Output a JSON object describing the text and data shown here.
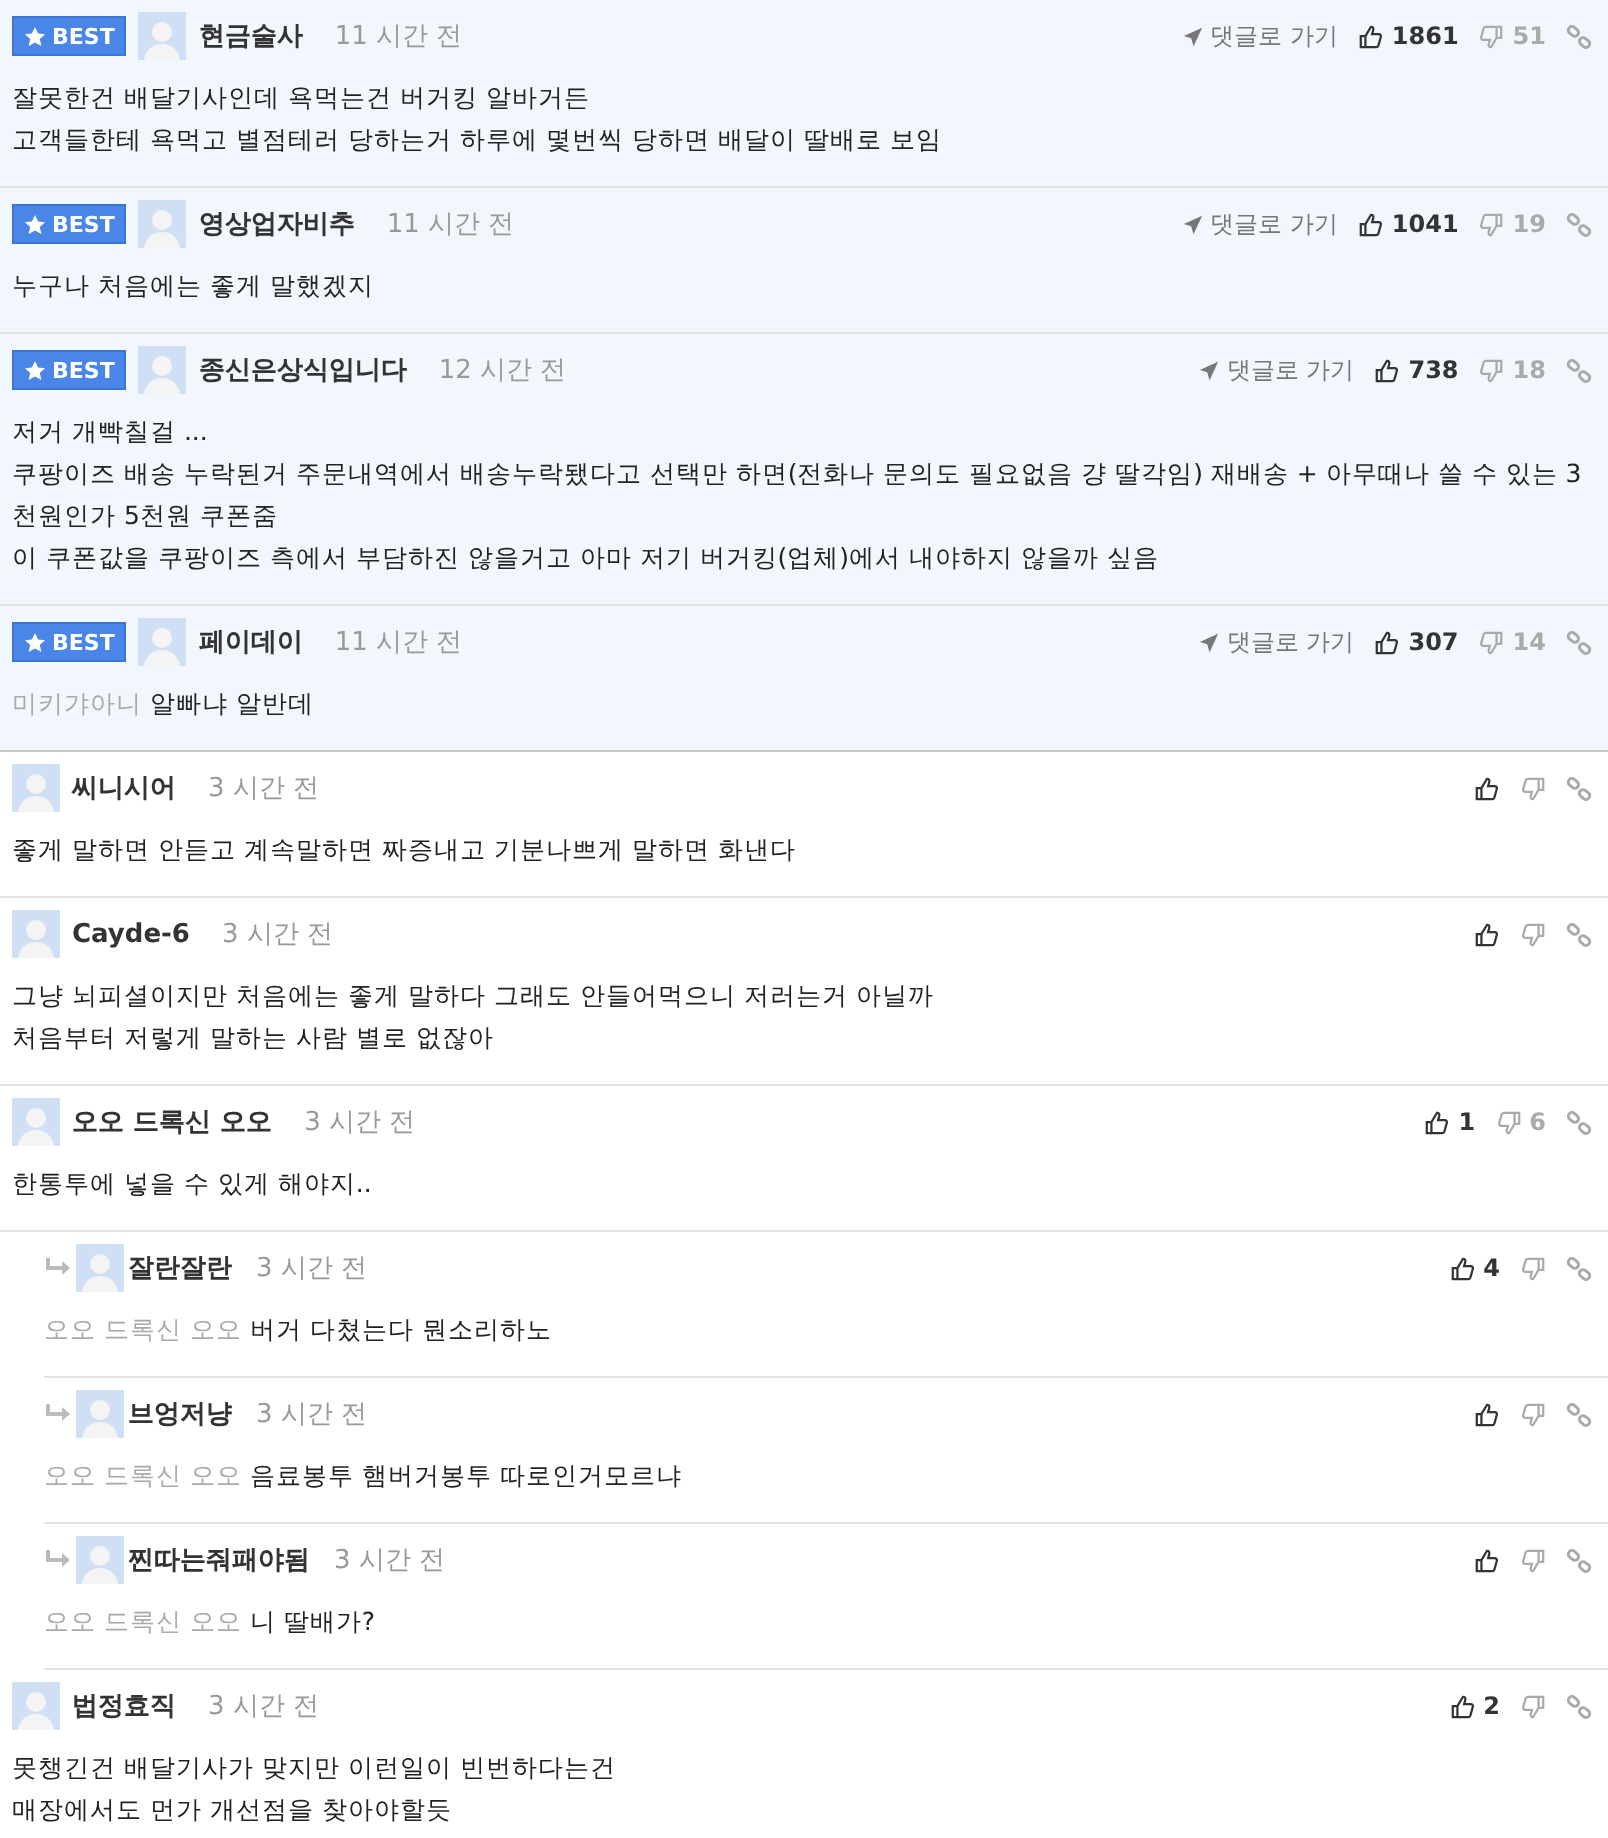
{
  "comments": [
    {
      "kind": "best",
      "badge": "BEST",
      "author": "현금술사",
      "time": "11 시간 전",
      "goto": "댓글로 가기",
      "likes": "1861",
      "dislikes": "51",
      "lines": [
        "잘못한건 배달기사인데 욕먹는건 버거킹 알바거든",
        "고객들한테 욕먹고 별점테러 당하는거 하루에 몇번씩 당하면 배달이 딸배로 보임"
      ]
    },
    {
      "kind": "best",
      "badge": "BEST",
      "author": "영상업자비추",
      "time": "11 시간 전",
      "goto": "댓글로 가기",
      "likes": "1041",
      "dislikes": "19",
      "lines": [
        "누구나 처음에는 좋게 말했겠지"
      ]
    },
    {
      "kind": "best",
      "badge": "BEST",
      "author": "종신은상식입니다",
      "time": "12 시간 전",
      "goto": "댓글로 가기",
      "likes": "738",
      "dislikes": "18",
      "lines": [
        "저거 개빡칠걸 ...",
        "쿠팡이즈 배송 누락된거 주문내역에서 배송누락됐다고 선택만 하면(전화나 문의도 필요없음 걍 딸각임) 재배송 + 아무때나 쓸 수 있는 3천원인가 5천원 쿠폰줌",
        "이 쿠폰값을 쿠팡이즈 측에서 부담하진 않을거고 아마 저기 버거킹(업체)에서 내야하지 않을까 싶음"
      ]
    },
    {
      "kind": "best",
      "badge": "BEST",
      "author": "페이데이",
      "time": "11 시간 전",
      "goto": "댓글로 가기",
      "likes": "307",
      "dislikes": "14",
      "mention": "미키갸아니",
      "lines": [
        "알빠냐 알반데"
      ]
    },
    {
      "kind": "normal",
      "author": "씨니시어",
      "time": "3 시간 전",
      "lines": [
        "좋게 말하면 안듣고 계속말하면 짜증내고 기분나쁘게 말하면 화낸다"
      ]
    },
    {
      "kind": "normal",
      "author": "Cayde-6",
      "time": "3 시간 전",
      "lines": [
        "그냥 뇌피셜이지만 처음에는 좋게 말하다 그래도 안들어먹으니 저러는거 아닐까",
        "처음부터 저렇게 말하는 사람 별로 없잖아"
      ]
    },
    {
      "kind": "normal",
      "author": "오오 드록신 오오",
      "time": "3 시간 전",
      "likes": "1",
      "dislikes": "6",
      "lines": [
        "한통투에 넣을 수 있게 해야지.."
      ]
    },
    {
      "kind": "reply",
      "author": "잘란잘란",
      "time": "3 시간 전",
      "likes": "4",
      "mention": "오오 드록신 오오",
      "lines": [
        "버거 다쳤는다 뭔소리하노"
      ]
    },
    {
      "kind": "reply",
      "author": "브엉저냥",
      "time": "3 시간 전",
      "mention": "오오 드록신 오오",
      "lines": [
        "음료봉투 햄버거봉투 따로인거모르냐"
      ]
    },
    {
      "kind": "reply",
      "author": "찐따는줘패야됨",
      "time": "3 시간 전",
      "mention": "오오 드록신 오오",
      "lines": [
        "니 딸배가?"
      ]
    },
    {
      "kind": "normal",
      "author": "법정효직",
      "time": "3 시간 전",
      "likes": "2",
      "lines": [
        "못챙긴건 배달기사가 맞지만 이런일이 빈번하다는건",
        "매장에서도 먼가 개선점을 찾아야할듯"
      ]
    }
  ]
}
